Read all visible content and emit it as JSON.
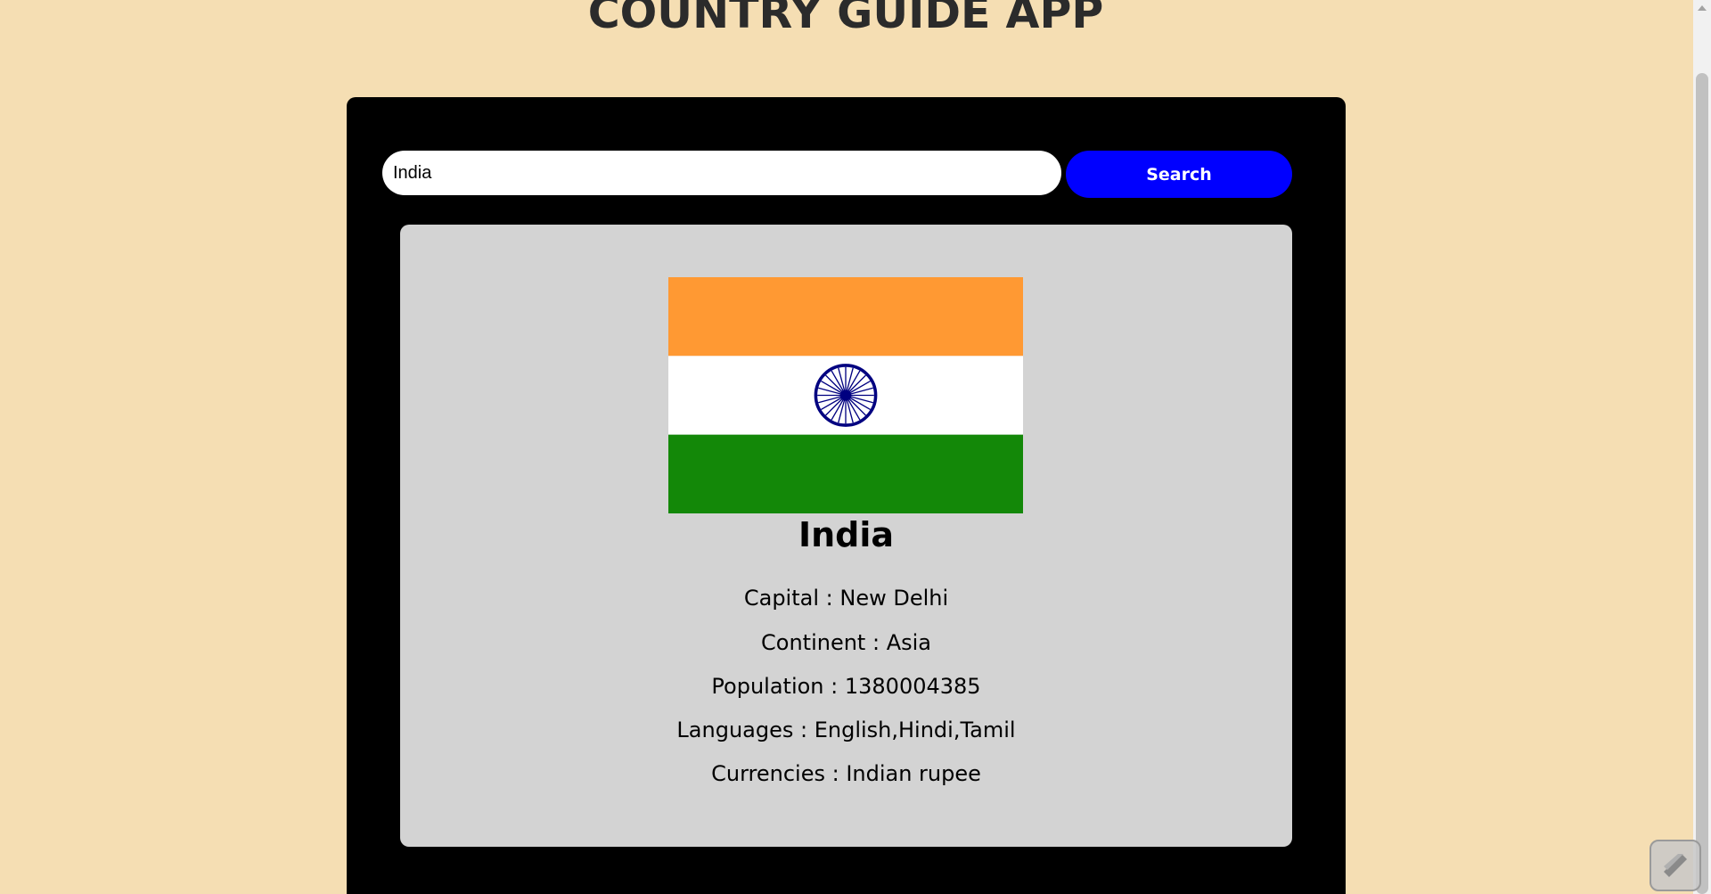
{
  "app": {
    "title": "COUNTRY GUIDE APP"
  },
  "search": {
    "value": "India",
    "button_label": "Search"
  },
  "country": {
    "name": "India",
    "flag_icon": "india-flag-icon",
    "details": [
      {
        "label": "Capital",
        "value": "New Delhi"
      },
      {
        "label": "Continent",
        "value": "Asia"
      },
      {
        "label": "Population",
        "value": "1380004385"
      },
      {
        "label": "Languages",
        "value": "English,Hindi,Tamil"
      },
      {
        "label": "Currencies",
        "value": "Indian rupee"
      }
    ]
  },
  "colors": {
    "background": "#f5deb3",
    "container": "#000000",
    "card": "#d3d3d3",
    "search_button": "#0000ff",
    "flag_saffron": "#ff9933",
    "flag_white": "#ffffff",
    "flag_green": "#138808",
    "flag_chakra": "#000080"
  }
}
